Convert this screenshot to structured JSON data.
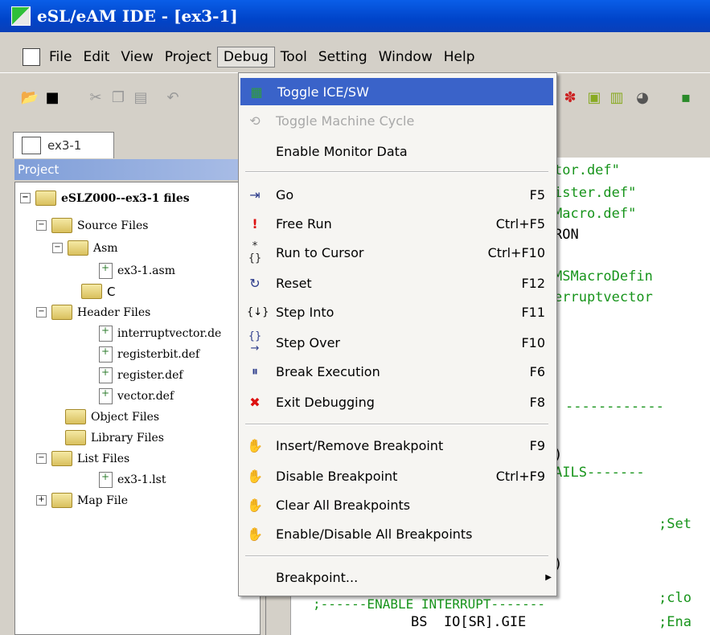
{
  "window": {
    "title": "eSL/eAM IDE - [ex3-1]"
  },
  "menubar": {
    "items": [
      "File",
      "Edit",
      "View",
      "Project",
      "Debug",
      "Tool",
      "Setting",
      "Window",
      "Help"
    ],
    "active": "Debug"
  },
  "tab": {
    "label": "ex3-1"
  },
  "project_panel": {
    "title": "Project",
    "tree": [
      {
        "label": "eSLZ000--ex3-1 files",
        "kind": "root"
      },
      {
        "label": "Source Files",
        "kind": "folder"
      },
      {
        "label": "Asm",
        "kind": "folder"
      },
      {
        "label": "ex3-1.asm",
        "kind": "file"
      },
      {
        "label": "C",
        "kind": "folder"
      },
      {
        "label": "Header Files",
        "kind": "folder"
      },
      {
        "label": "interruptvector.de",
        "kind": "file"
      },
      {
        "label": "registerbit.def",
        "kind": "file"
      },
      {
        "label": "register.def",
        "kind": "file"
      },
      {
        "label": "vector.def",
        "kind": "file"
      },
      {
        "label": "Object Files",
        "kind": "folder"
      },
      {
        "label": "Library Files",
        "kind": "folder"
      },
      {
        "label": "List Files",
        "kind": "folder"
      },
      {
        "label": "ex3-1.lst",
        "kind": "file"
      },
      {
        "label": "Map File",
        "kind": "folder"
      }
    ]
  },
  "editor": {
    "lines": [
      "tor.def\"",
      "ister.def\"",
      "Macro.def\"",
      "RON",
      "MSMacroDefin",
      "erruptvector",
      "------------",
      ")",
      "AILS-------",
      ";Set",
      ")",
      ";clo",
      ";------ENABLE INTERRUPT-------",
      "BS  IO[SR].GIE",
      ";Ena"
    ]
  },
  "debug_menu": {
    "items": [
      {
        "label": "Toggle ICE/SW",
        "shortcut": "",
        "icon": "ice-chip-icon",
        "glyph": "▦",
        "state": "highlight"
      },
      {
        "label": "Toggle Machine Cycle",
        "shortcut": "",
        "icon": "machine-cycle-icon",
        "glyph": "⟲",
        "state": "disabled"
      },
      {
        "label": "Enable Monitor Data",
        "shortcut": "",
        "icon": "",
        "glyph": "",
        "state": "normal"
      },
      {
        "label": "Go",
        "shortcut": "F5",
        "icon": "go-icon",
        "glyph": "⇥",
        "state": "normal"
      },
      {
        "label": "Free Run",
        "shortcut": "Ctrl+F5",
        "icon": "free-run-icon",
        "glyph": "!",
        "state": "normal"
      },
      {
        "label": "Run to Cursor",
        "shortcut": "Ctrl+F10",
        "icon": "run-to-cursor-icon",
        "glyph": "*{}",
        "state": "normal"
      },
      {
        "label": "Reset",
        "shortcut": "F12",
        "icon": "reset-icon",
        "glyph": "↻",
        "state": "normal"
      },
      {
        "label": "Step Into",
        "shortcut": "F11",
        "icon": "step-into-icon",
        "glyph": "{↓}",
        "state": "normal"
      },
      {
        "label": "Step Over",
        "shortcut": "F10",
        "icon": "step-over-icon",
        "glyph": "{}→",
        "state": "normal"
      },
      {
        "label": "Break Execution",
        "shortcut": "F6",
        "icon": "break-execution-icon",
        "glyph": "⏸",
        "state": "normal"
      },
      {
        "label": "Exit Debugging",
        "shortcut": "F8",
        "icon": "exit-debugging-icon",
        "glyph": "✖",
        "state": "normal"
      },
      {
        "label": "Insert/Remove Breakpoint",
        "shortcut": "F9",
        "icon": "breakpoint-hand-icon",
        "glyph": "✋",
        "state": "normal"
      },
      {
        "label": "Disable Breakpoint",
        "shortcut": "Ctrl+F9",
        "icon": "disable-breakpoint-icon",
        "glyph": "✋",
        "state": "normal"
      },
      {
        "label": "Clear All Breakpoints",
        "shortcut": "",
        "icon": "clear-breakpoints-icon",
        "glyph": "✋",
        "state": "normal"
      },
      {
        "label": "Enable/Disable All Breakpoints",
        "shortcut": "",
        "icon": "toggle-all-breakpoints-icon",
        "glyph": "✋",
        "state": "normal"
      },
      {
        "label": "Breakpoint...",
        "shortcut": "",
        "icon": "",
        "glyph": "",
        "state": "submenu"
      }
    ]
  },
  "colors": {
    "titlebar": "#0044c9",
    "highlight": "#3a63c9",
    "code_green": "#17941b"
  }
}
